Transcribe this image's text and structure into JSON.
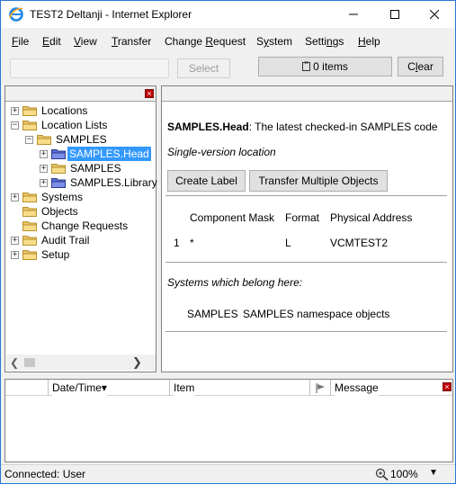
{
  "window": {
    "title": "TEST2 Deltanji - Internet Explorer",
    "icons": [
      "ie-logo-icon",
      "minimize-icon",
      "maximize-icon",
      "close-icon"
    ]
  },
  "menu": [
    {
      "label": "File",
      "accel": "F",
      "rest": "ile"
    },
    {
      "label": "Edit",
      "accel": "E",
      "rest": "dit"
    },
    {
      "label": "View",
      "accel": "V",
      "rest": "iew"
    },
    {
      "label": "Transfer",
      "accel": "T",
      "rest": "ransfer"
    },
    {
      "label": "Change Request",
      "pre": "Change ",
      "accel": "R",
      "rest": "equest"
    },
    {
      "label": "System",
      "pre": "S",
      "accel": "y",
      "rest": "stem"
    },
    {
      "label": "Settings",
      "pre": "Setti",
      "accel": "n",
      "rest": "gs"
    },
    {
      "label": "Help",
      "accel": "H",
      "rest": "elp"
    }
  ],
  "toolbar": {
    "search_value": "",
    "select_label": "Select",
    "items_label": "0 items",
    "clear_label": "Clear",
    "clear_accel": "l"
  },
  "tree": {
    "items": [
      {
        "label": "Locations",
        "expander": "+",
        "level": 0
      },
      {
        "label": "Location Lists",
        "expander": "−",
        "level": 0
      },
      {
        "label": "SAMPLES",
        "expander": "−",
        "level": 1
      },
      {
        "label": "SAMPLES.Head",
        "expander": "+",
        "level": 2,
        "selected": true,
        "icon": "location-icon"
      },
      {
        "label": "SAMPLES",
        "expander": "+",
        "level": 2
      },
      {
        "label": "SAMPLES.Library",
        "expander": "+",
        "level": 2,
        "icon": "location-icon"
      },
      {
        "label": "Systems",
        "expander": "+",
        "level": 0
      },
      {
        "label": "Objects",
        "expander": "",
        "level": 0
      },
      {
        "label": "Change Requests",
        "expander": "",
        "level": 0
      },
      {
        "label": "Audit Trail",
        "expander": "+",
        "level": 0
      },
      {
        "label": "Setup",
        "expander": "+",
        "level": 0
      }
    ]
  },
  "detail": {
    "name": "SAMPLES.Head",
    "description": ": The latest checked-in SAMPLES code",
    "version_note": "Single-version location",
    "create_label_button": "Create Label",
    "transfer_button": "Transfer Multiple Objects",
    "table": {
      "headers": [
        "Component Mask",
        "Format",
        "Physical Address"
      ],
      "rows": [
        {
          "index": "1",
          "mask": "*",
          "format": "L",
          "address": "VCMTEST2"
        }
      ]
    },
    "systems_heading": "Systems which belong here:",
    "systems": [
      {
        "name": "SAMPLES",
        "description": "SAMPLES namespace objects"
      }
    ]
  },
  "log": {
    "columns": [
      "Date/Time",
      "Item",
      "Message"
    ],
    "sort_indicator": "▾"
  },
  "status": {
    "text": "Connected: User",
    "zoom": "100%"
  },
  "colors": {
    "selection": "#3399ff",
    "window_border": "#2b79d4",
    "folder": "#e8c468",
    "pane_close": "#c00000"
  }
}
